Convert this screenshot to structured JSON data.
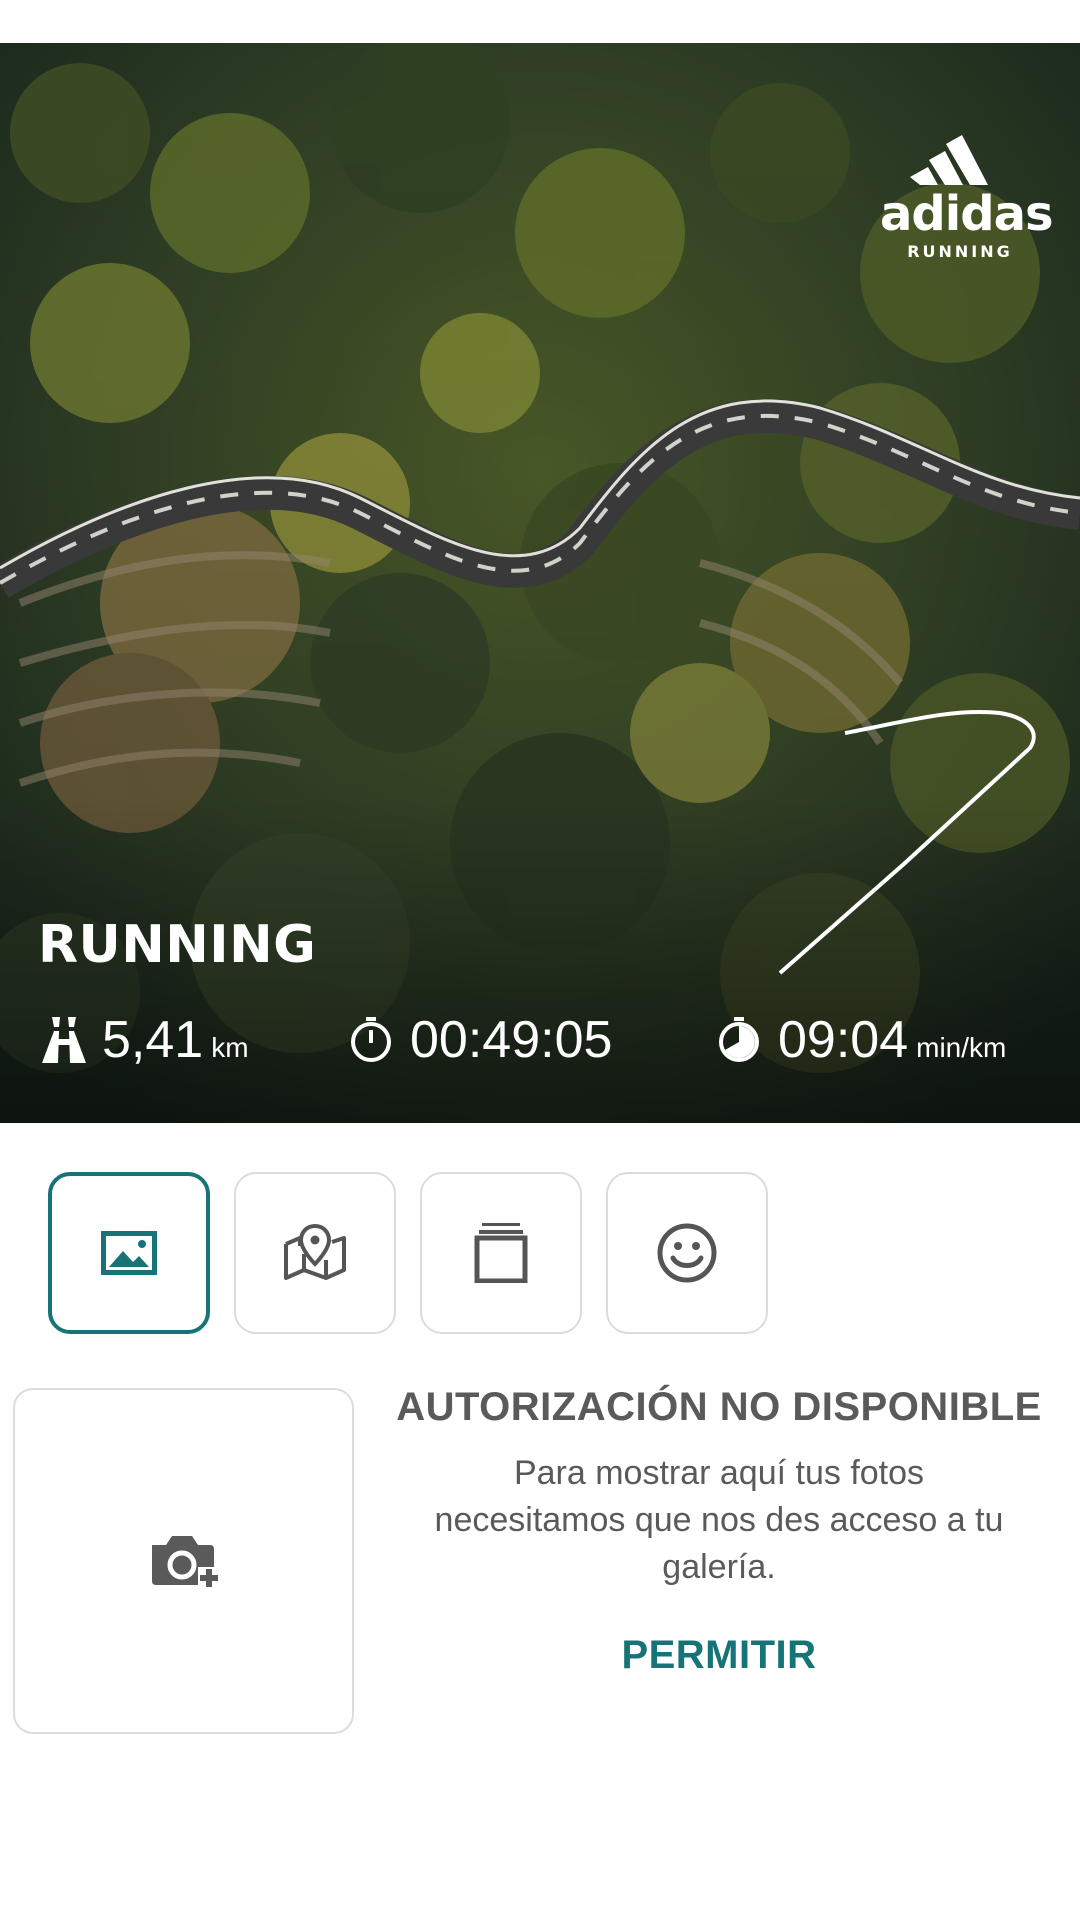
{
  "hero": {
    "brand_logo": "adidas",
    "brand_sub": "RUNNING",
    "activity": "RUNNING",
    "stats": {
      "distance_value": "5,41",
      "distance_unit": "km",
      "duration_value": "00:49:05",
      "pace_value": "09:04",
      "pace_unit": "min/km"
    },
    "icons": {
      "distance": "road-icon",
      "duration": "stopwatch-icon",
      "pace": "pace-icon"
    }
  },
  "tabs": [
    {
      "name": "photo",
      "icon": "image-icon",
      "active": true
    },
    {
      "name": "map",
      "icon": "map-icon",
      "active": false
    },
    {
      "name": "layers",
      "icon": "layers-icon",
      "active": false
    },
    {
      "name": "sticker",
      "icon": "smiley-icon",
      "active": false
    }
  ],
  "permission": {
    "heading": "AUTORIZACIÓN NO DISPONIBLE",
    "body": "Para mostrar aquí tus fotos necesitamos que nos des acceso a tu galería.",
    "allow_label": "PERMITIR"
  },
  "colors": {
    "accent": "#167479",
    "text": "#5a5a5a",
    "border": "#dcdcdc"
  }
}
